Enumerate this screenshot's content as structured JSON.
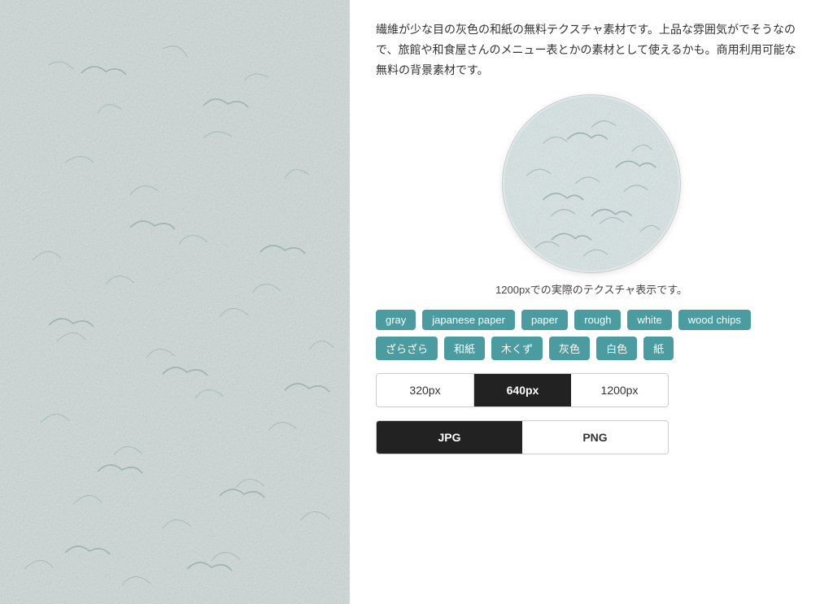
{
  "left": {
    "alt": "Gray Japanese washi paper texture"
  },
  "right": {
    "description": "繊維が少な目の灰色の和紙の無料テクスチャ素材です。上品な雰囲気がでそうなので、旅館や和食屋さんのメニュー表とかの素材として使えるかも。商用利用可能な無料の背景素材です。",
    "preview_label": "1200pxでの実際のテクスチャ表示です。",
    "tags": [
      {
        "id": "tag-gray",
        "label": "gray"
      },
      {
        "id": "tag-japanese-paper",
        "label": "japanese paper"
      },
      {
        "id": "tag-paper",
        "label": "paper"
      },
      {
        "id": "tag-rough",
        "label": "rough"
      },
      {
        "id": "tag-white",
        "label": "white"
      },
      {
        "id": "tag-wood-chips",
        "label": "wood chips"
      },
      {
        "id": "tag-zazagaza",
        "label": "ざらざら"
      },
      {
        "id": "tag-washi",
        "label": "和紙"
      },
      {
        "id": "tag-kikuzu",
        "label": "木くず"
      },
      {
        "id": "tag-haishoku",
        "label": "灰色"
      },
      {
        "id": "tag-hakushoku",
        "label": "白色"
      },
      {
        "id": "tag-kami",
        "label": "紙"
      }
    ],
    "sizes": [
      {
        "label": "320px",
        "active": false
      },
      {
        "label": "640px",
        "active": true
      },
      {
        "label": "1200px",
        "active": false
      }
    ],
    "formats": [
      {
        "label": "JPG",
        "active": true
      },
      {
        "label": "PNG",
        "active": false
      }
    ]
  }
}
